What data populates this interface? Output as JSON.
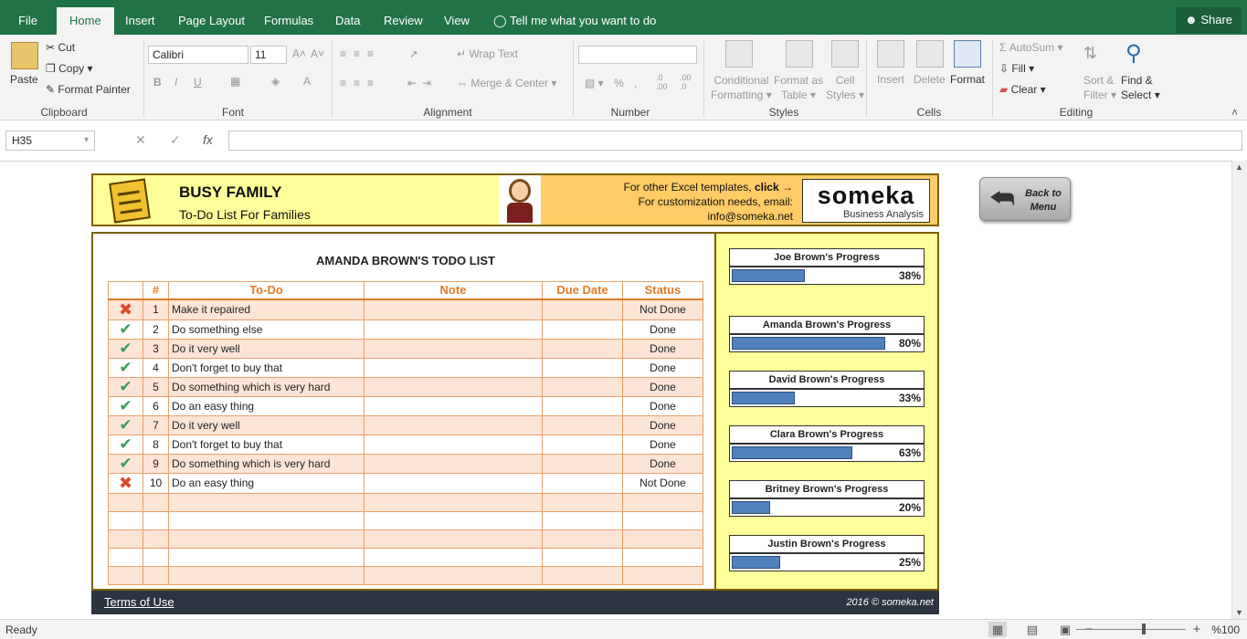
{
  "tabs": [
    "File",
    "Home",
    "Insert",
    "Page Layout",
    "Formulas",
    "Data",
    "Review",
    "View"
  ],
  "tell_me": "Tell me what you want to do",
  "share": "Share",
  "ribbon": {
    "clipboard": {
      "paste": "Paste",
      "cut": "Cut",
      "copy": "Copy",
      "format_painter": "Format Painter",
      "label": "Clipboard"
    },
    "font": {
      "name": "Calibri",
      "size": "11",
      "bold": "B",
      "italic": "I",
      "underline": "U",
      "label": "Font"
    },
    "alignment": {
      "wrap": "Wrap Text",
      "merge": "Merge & Center",
      "label": "Alignment"
    },
    "number": {
      "format": "",
      "percent": "%",
      "label": "Number"
    },
    "styles": {
      "conditional": "Conditional",
      "formatting": "Formatting",
      "format_as": "Format as",
      "table": "Table",
      "cell": "Cell",
      "cell_styles": "Styles",
      "label": "Styles"
    },
    "cells": {
      "insert": "Insert",
      "delete": "Delete",
      "format": "Format",
      "label": "Cells"
    },
    "editing": {
      "autosum": "AutoSum",
      "fill": "Fill",
      "clear": "Clear",
      "sort": "Sort &",
      "filter": "Filter",
      "find": "Find &",
      "select": "Select",
      "label": "Editing"
    }
  },
  "formula_bar": {
    "name_box": "H35",
    "fx": "fx",
    "value": ""
  },
  "header": {
    "title": "BUSY FAMILY",
    "subtitle": "To-Do List For Families",
    "info_line1": "For other Excel templates,",
    "info_click": "click",
    "info_line2": "For customization needs, email:",
    "info_email": "info@someka.net",
    "logo_word": "someka",
    "logo_sub": "Business Analysis",
    "back_label": "Back to Menu"
  },
  "list": {
    "title": "AMANDA BROWN'S TODO LIST",
    "columns": [
      "",
      "#",
      "To-Do",
      "Note",
      "Due Date",
      "Status"
    ],
    "rows": [
      {
        "icon": "cross-icon",
        "num": "1",
        "todo": "Make it repaired",
        "note": "",
        "due": "",
        "status": "Not Done"
      },
      {
        "icon": "check-icon",
        "num": "2",
        "todo": "Do something else",
        "note": "",
        "due": "",
        "status": "Done"
      },
      {
        "icon": "check-icon",
        "num": "3",
        "todo": "Do it very well",
        "note": "",
        "due": "",
        "status": "Done"
      },
      {
        "icon": "check-icon",
        "num": "4",
        "todo": "Don't forget to buy that",
        "note": "",
        "due": "",
        "status": "Done"
      },
      {
        "icon": "check-icon",
        "num": "5",
        "todo": "Do something which is very hard",
        "note": "",
        "due": "",
        "status": "Done"
      },
      {
        "icon": "check-icon",
        "num": "6",
        "todo": "Do an easy thing",
        "note": "",
        "due": "",
        "status": "Done"
      },
      {
        "icon": "check-icon",
        "num": "7",
        "todo": "Do it very well",
        "note": "",
        "due": "",
        "status": "Done"
      },
      {
        "icon": "check-icon",
        "num": "8",
        "todo": "Don't forget to buy that",
        "note": "",
        "due": "",
        "status": "Done"
      },
      {
        "icon": "check-icon",
        "num": "9",
        "todo": "Do something which is very hard",
        "note": "",
        "due": "",
        "status": "Done"
      },
      {
        "icon": "cross-icon",
        "num": "10",
        "todo": "Do an easy thing",
        "note": "",
        "due": "",
        "status": "Not Done"
      },
      {
        "icon": "",
        "num": "",
        "todo": "",
        "note": "",
        "due": "",
        "status": ""
      },
      {
        "icon": "",
        "num": "",
        "todo": "",
        "note": "",
        "due": "",
        "status": ""
      },
      {
        "icon": "",
        "num": "",
        "todo": "",
        "note": "",
        "due": "",
        "status": ""
      },
      {
        "icon": "",
        "num": "",
        "todo": "",
        "note": "",
        "due": "",
        "status": ""
      },
      {
        "icon": "",
        "num": "",
        "todo": "",
        "note": "",
        "due": "",
        "status": ""
      }
    ]
  },
  "progress": [
    {
      "name": "Joe Brown's Progress",
      "pct_label": "38%",
      "value": 0.38
    },
    {
      "name": "Amanda Brown's Progress",
      "pct_label": "80%",
      "value": 0.8
    },
    {
      "name": "David Brown's Progress",
      "pct_label": "33%",
      "value": 0.33
    },
    {
      "name": "Clara Brown's Progress",
      "pct_label": "63%",
      "value": 0.63
    },
    {
      "name": "Britney Brown's Progress",
      "pct_label": "20%",
      "value": 0.2
    },
    {
      "name": "Justin Brown's Progress",
      "pct_label": "25%",
      "value": 0.25
    }
  ],
  "footer": {
    "terms": "Terms of Use",
    "copyright": "2016 © someka.net"
  },
  "status_bar": {
    "status": "Ready",
    "zoom": "%100"
  },
  "colors": {
    "excel_green": "#217346",
    "header_yellow": "#ffff99",
    "header_orange": "#ffcc66",
    "row_peach": "#fde5d6",
    "accent_orange": "#e07b2a",
    "bar_blue": "#4f81bd",
    "footer_dark": "#2c3440"
  }
}
